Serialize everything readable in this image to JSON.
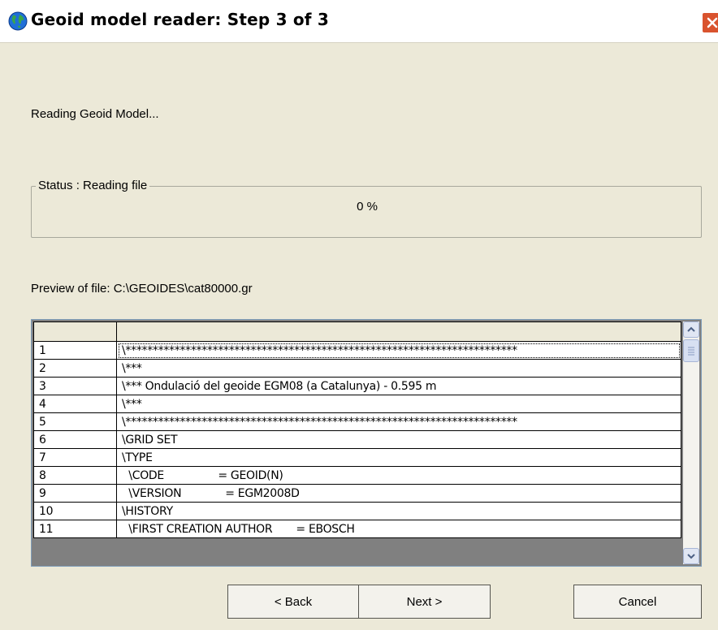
{
  "window": {
    "title": "Geoid model reader: Step 3 of 3"
  },
  "heading": "Reading Geoid Model...",
  "status": {
    "legend": "Status : Reading file",
    "progress_text": "0 %",
    "progress_percent": 0
  },
  "preview": {
    "label": "Preview of file: C:\\GEOIDES\\cat80000.gr",
    "rows": [
      {
        "num": "1",
        "text": "\\************************************************************************"
      },
      {
        "num": "2",
        "text": "\\***"
      },
      {
        "num": "3",
        "text": "\\*** Ondulació del geoide EGM08 (a Catalunya) - 0.595 m"
      },
      {
        "num": "4",
        "text": "\\***"
      },
      {
        "num": "5",
        "text": "\\************************************************************************"
      },
      {
        "num": "6",
        "text": "\\GRID SET"
      },
      {
        "num": "7",
        "text": "\\TYPE"
      },
      {
        "num": "8",
        "text": "  \\CODE                = GEOID(N)"
      },
      {
        "num": "9",
        "text": "  \\VERSION             = EGM2008D"
      },
      {
        "num": "10",
        "text": "\\HISTORY"
      },
      {
        "num": "11",
        "text": "  \\FIRST CREATION AUTHOR       = EBOSCH"
      }
    ]
  },
  "buttons": {
    "back": "< Back",
    "next": "Next >",
    "cancel": "Cancel"
  }
}
